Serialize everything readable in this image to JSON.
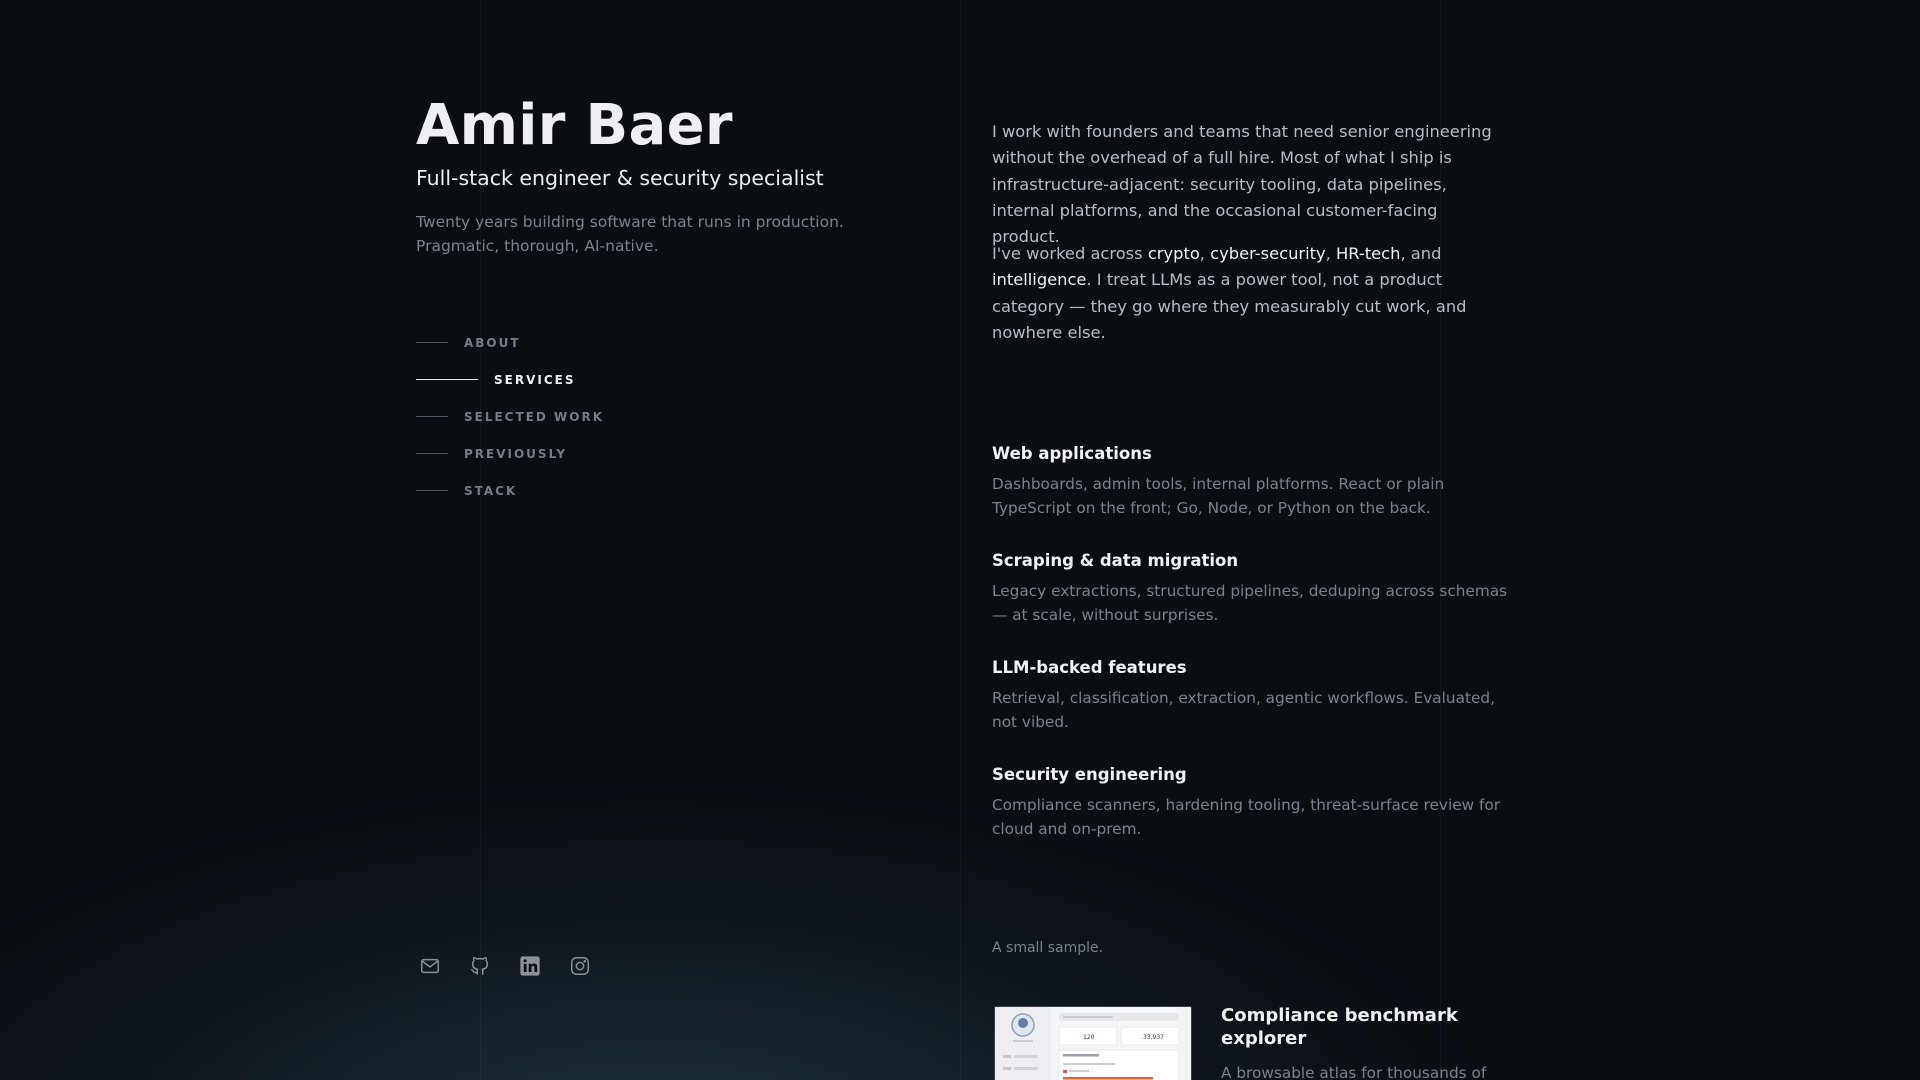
{
  "profile": {
    "name": "Amir Baer",
    "role": "Full-stack engineer & security specialist",
    "tagline_lines": [
      "Twenty years building software that runs in production.",
      "Pragmatic, thorough, AI-native."
    ]
  },
  "nav": {
    "active": "SERVICES",
    "items": [
      {
        "label": "ABOUT"
      },
      {
        "label": "SERVICES"
      },
      {
        "label": "SELECTED WORK"
      },
      {
        "label": "PREVIOUSLY"
      },
      {
        "label": "STACK"
      }
    ]
  },
  "socials": [
    {
      "icon": "mail-icon"
    },
    {
      "icon": "github-icon"
    },
    {
      "icon": "linkedin-icon"
    },
    {
      "icon": "instagram-icon"
    }
  ],
  "about": {
    "paragraph1": "I work with founders and teams that need senior engineering without the overhead of a full hire. Most of what I ship is infrastructure-adjacent: security tooling, data pipelines, internal platforms, and the occasional customer-facing product.",
    "p2_intro": "I've worked across ",
    "p2_domains": [
      "crypto",
      "cyber-security",
      "HR-tech",
      "intelligence"
    ],
    "p2_sep1": ", ",
    "p2_sep2": ", ",
    "p2_sep3": ", and ",
    "p2_outro": ". I treat LLMs as a power tool, not a product category — they go where they measurably cut work, and nowhere else."
  },
  "services": [
    {
      "title": "Web applications",
      "description": "Dashboards, admin tools, internal platforms. React or plain TypeScript on the front; Go, Node, or Python on the back."
    },
    {
      "title": "Scraping & data migration",
      "description": "Legacy extractions, structured pipelines, deduping across schemas — at scale, without surprises."
    },
    {
      "title": "LLM-backed features",
      "description": "Retrieval, classification, extraction, agentic workflows. Evaluated, not vibed."
    },
    {
      "title": "Security engineering",
      "description": "Compliance scanners, hardening tooling, threat-surface review for cloud and on-prem."
    }
  ],
  "work": {
    "intro": "A small sample.",
    "items": [
      {
        "title": "Compliance benchmark explorer",
        "description": "A browsable atlas for thousands of",
        "thumbnail": {
          "stat1": "120",
          "stat2": "33,937"
        }
      }
    ]
  },
  "colors": {
    "background": "#0a0d12",
    "text_primary": "#f1f3f5",
    "text_secondary": "#b8bdc5",
    "text_muted": "#7b818a",
    "nav_active": "#eef0f3"
  }
}
